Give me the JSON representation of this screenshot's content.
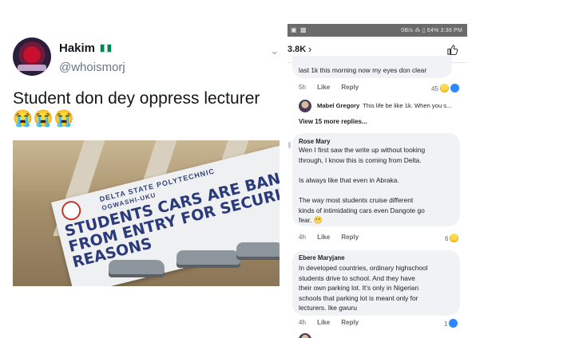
{
  "tweet": {
    "display_name": "Hakim",
    "handle": "@whoismorj",
    "text": "Student don dey oppress lecturer",
    "emojis": "😭😭😭",
    "banner": {
      "line1": "DELTA STATE POLYTECHNIC",
      "line2": "OGWASHI-UKU",
      "line3": "STUDENTS CARS ARE BANNED FROM ENTRY FOR SECURITY REASONS"
    }
  },
  "facebook": {
    "status_bar": "0B/s ⁂ ▯ 64% 3:36 PM",
    "reaction_count": "3.8K",
    "comments": [
      {
        "text": "last 1k this morning now my eyes don clear",
        "time": "5h",
        "like_label": "Like",
        "reply_label": "Reply",
        "reaction_count": "45",
        "reply_preview": {
          "name": "Mabel Gregory",
          "text": "This life be like 1k. When you s..."
        },
        "view_more": "View 15 more replies..."
      },
      {
        "name": "Rose Mary",
        "text_lines": [
          "Wen I first saw the write up without looking",
          "through, I know this is coming from Delta.",
          "",
          "Is always like that even in Abraka.",
          "",
          "The way most students cruise different",
          "kinds of intimidating cars even Dangote go",
          "fear."
        ],
        "time": "4h",
        "like_label": "Like",
        "reply_label": "Reply",
        "reaction_count": "6"
      },
      {
        "name": "Ebere Maryjane",
        "text_lines": [
          "In developed countries, ordinary highschool",
          "students drive to school. And they have",
          "their own parking lot. It's only in Nigerian",
          "schools that parking lot is meant only for",
          "lecturers. Ike gwuru"
        ],
        "time": "4h",
        "like_label": "Like",
        "reply_label": "Reply",
        "reaction_count": "1"
      }
    ]
  }
}
